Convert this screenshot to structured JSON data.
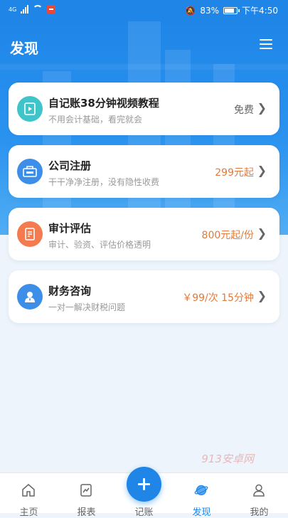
{
  "status_bar": {
    "network": "4G",
    "battery": "83%",
    "time": "下午4:50"
  },
  "header": {
    "title": "发现"
  },
  "cards": [
    {
      "title": "自记账38分钟视频教程",
      "subtitle": "不用会计基础，看完就会",
      "price": "免费",
      "icon": "video-tutorial-icon",
      "icon_color": "#3fc4c9",
      "price_color": "#666666"
    },
    {
      "title": "公司注册",
      "subtitle": "干干净净注册，没有隐性收费",
      "price": "299元起",
      "icon": "company-registration-icon",
      "icon_color": "#3d8ee9",
      "price_color": "#e07b3c"
    },
    {
      "title": "审计评估",
      "subtitle": "审计、验资、评估价格透明",
      "price": "800元起/份",
      "icon": "audit-document-icon",
      "icon_color": "#f47a50",
      "price_color": "#e07b3c"
    },
    {
      "title": "财务咨询",
      "subtitle": "一对一解决财税问题",
      "price": "￥99/次 15分钟",
      "icon": "consultant-person-icon",
      "icon_color": "#3d8ee9",
      "price_color": "#e07b3c"
    }
  ],
  "watermark": "913安卓网",
  "tabbar": {
    "tabs": [
      {
        "label": "主页",
        "icon": "home-icon"
      },
      {
        "label": "报表",
        "icon": "report-icon"
      },
      {
        "label": "记账",
        "icon": "add-icon"
      },
      {
        "label": "发现",
        "icon": "discover-planet-icon",
        "active": true
      },
      {
        "label": "我的",
        "icon": "profile-icon"
      }
    ]
  },
  "colors": {
    "primary": "#1f86e8",
    "accent_price": "#e07b3c",
    "background": "#eef4fb"
  }
}
